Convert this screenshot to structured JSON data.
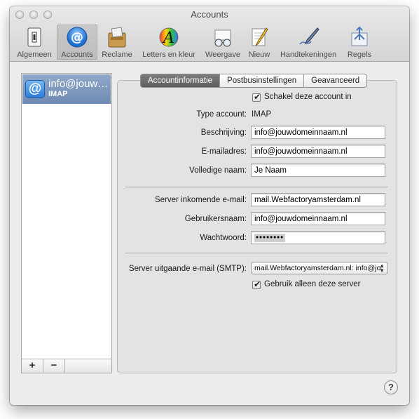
{
  "window": {
    "title": "Accounts"
  },
  "toolbar": {
    "items": [
      {
        "label": "Algemeen",
        "icon": "switch-icon"
      },
      {
        "label": "Accounts",
        "icon": "at-sign-icon"
      },
      {
        "label": "Reclame",
        "icon": "junk-mail-icon"
      },
      {
        "label": "Letters en kleur",
        "icon": "fonts-colors-icon"
      },
      {
        "label": "Weergave",
        "icon": "viewing-glasses-icon"
      },
      {
        "label": "Nieuw",
        "icon": "composing-pencil-icon"
      },
      {
        "label": "Handtekeningen",
        "icon": "signature-pen-icon"
      },
      {
        "label": "Regels",
        "icon": "rules-icon"
      }
    ],
    "selected": "Accounts"
  },
  "sidebar": {
    "accounts": [
      {
        "name": "info@jouw…",
        "type": "IMAP"
      }
    ],
    "add_label": "+",
    "remove_label": "−"
  },
  "tabs": [
    "Accountinformatie",
    "Postbusinstellingen",
    "Geavanceerd"
  ],
  "active_tab": "Accountinformatie",
  "form": {
    "enable_label": "Schakel deze account in",
    "enable_checked": true,
    "account_type_label": "Type account:",
    "account_type_value": "IMAP",
    "description_label": "Beschrijving:",
    "description_value": "info@jouwdomeinnaam.nl",
    "email_label": "E-mailadres:",
    "email_value": "info@jouwdomeinnaam.nl",
    "fullname_label": "Volledige naam:",
    "fullname_value": "Je Naam",
    "incoming_label": "Server inkomende e-mail:",
    "incoming_value": "mail.Webfactoryamsterdam.nl",
    "username_label": "Gebruikersnaam:",
    "username_value": "info@jouwdomeinnaam.nl",
    "password_label": "Wachtwoord:",
    "password_value": "••••••••",
    "smtp_label": "Server uitgaande e-mail (SMTP):",
    "smtp_value": "mail.Webfactoryamsterdam.nl: info@jo",
    "only_server_label": "Gebruik alleen deze server",
    "only_server_checked": true
  },
  "help": {
    "label": "?"
  }
}
